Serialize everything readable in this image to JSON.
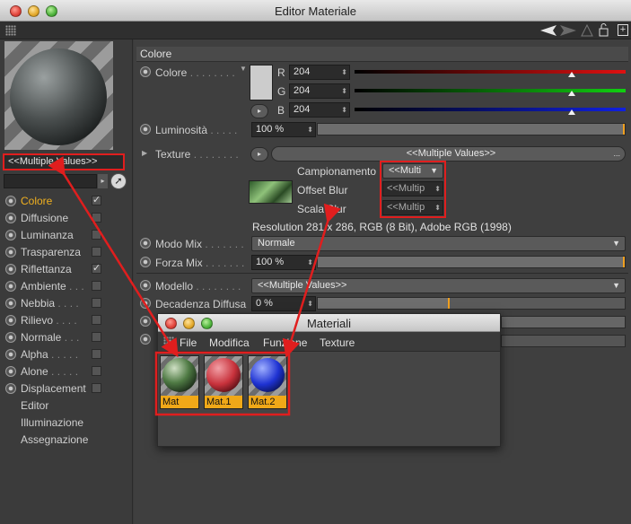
{
  "window": {
    "title": "Editor Materiale"
  },
  "left": {
    "multi_values": "<<Multiple Values>>",
    "channels": [
      {
        "label": "Colore",
        "dots": "",
        "checked": true,
        "active": true
      },
      {
        "label": "Diffusione",
        "dots": " ",
        "checked": false
      },
      {
        "label": "Luminanza",
        "dots": " ",
        "checked": false
      },
      {
        "label": "Trasparenza",
        "dots": "",
        "checked": false
      },
      {
        "label": "Riflettanza",
        "dots": "",
        "checked": true
      },
      {
        "label": "Ambiente",
        "dots": ". . .",
        "checked": false
      },
      {
        "label": "Nebbia",
        "dots": ". . . .",
        "checked": false
      },
      {
        "label": "Rilievo",
        "dots": ". . . .",
        "checked": false
      },
      {
        "label": "Normale",
        "dots": ". . .",
        "checked": false
      },
      {
        "label": "Alpha",
        "dots": ". . . . .",
        "checked": false
      },
      {
        "label": "Alone",
        "dots": ". . . . .",
        "checked": false
      },
      {
        "label": "Displacement",
        "dots": "",
        "checked": false
      }
    ],
    "extra": [
      "Editor",
      "Illuminazione",
      "Assegnazione"
    ]
  },
  "section_title": "Colore",
  "colore": {
    "label": "Colore",
    "dots": ". . . . . . . .",
    "swatch": "#cccccc",
    "r_label": "R",
    "r_value": "204",
    "g_label": "G",
    "g_value": "204",
    "b_label": "B",
    "b_value": "204",
    "level": 0.8
  },
  "luminosita": {
    "label": "Luminosità",
    "dots": ". . . . .",
    "value": "100 %"
  },
  "texture": {
    "label": "Texture",
    "dots": ". . . . . . . .",
    "value": "<<Multiple Values>>",
    "more": "...",
    "campionamento_label": "Campionamento",
    "campionamento_value": "<<Multi",
    "offset_label": "Offset Blur",
    "offset_value": "<<Multip",
    "scala_label": "Scala Blur",
    "scala_value": "<<Multip",
    "resolution": "Resolution 281 x 286, RGB (8 Bit), Adobe RGB (1998)"
  },
  "modo_mix": {
    "label": "Modo Mix",
    "dots": ". . . . . . .",
    "value": "Normale"
  },
  "forza_mix": {
    "label": "Forza Mix",
    "dots": ". . . . . . .",
    "value": "100 %"
  },
  "modello": {
    "label": "Modello",
    "dots": ". . . . . . . .",
    "value": "<<Multiple Values>>"
  },
  "decadenza": {
    "label": "Decadenza Diffusa",
    "value": "0 %"
  },
  "materiali": {
    "title": "Materiali",
    "menu": [
      "File",
      "Modifica",
      "Funzione",
      "Texture"
    ],
    "items": [
      {
        "name": "Mat"
      },
      {
        "name": "Mat.1"
      },
      {
        "name": "Mat.2"
      }
    ]
  },
  "colors": {
    "accent": "#f0a818",
    "annotation_red": "#e01e1e",
    "mat1": "#c8323c",
    "mat2": "#1e32d2"
  }
}
